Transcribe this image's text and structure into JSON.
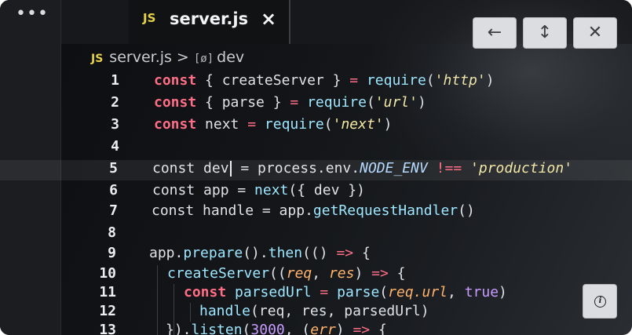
{
  "activity_bar": {
    "menu_icon": "more-horizontal-icon",
    "menu_glyph": "•••"
  },
  "tab": {
    "icon_label": "JS",
    "file_name": "server.js",
    "close_glyph": "×"
  },
  "breadcrumb": {
    "file_icon_label": "JS",
    "file": "server.js",
    "separator": ">",
    "symbol_icon": "[ø]",
    "symbol": "dev"
  },
  "code_lines": [
    {
      "n": "1",
      "tokens": [
        [
          "kw",
          "const "
        ],
        [
          "t",
          "{ createServer } "
        ],
        [
          "op",
          "= "
        ],
        [
          "fn",
          "require"
        ],
        [
          "t",
          "("
        ],
        [
          "str",
          "'http'"
        ],
        [
          "t",
          ")"
        ]
      ]
    },
    {
      "n": "2",
      "tokens": [
        [
          "kw",
          "const "
        ],
        [
          "t",
          "{ parse } "
        ],
        [
          "op",
          "= "
        ],
        [
          "fn",
          "require"
        ],
        [
          "t",
          "("
        ],
        [
          "str",
          "'url'"
        ],
        [
          "t",
          ")"
        ]
      ]
    },
    {
      "n": "3",
      "tokens": [
        [
          "kw",
          "const "
        ],
        [
          "t",
          "next "
        ],
        [
          "op",
          "= "
        ],
        [
          "fn",
          "require"
        ],
        [
          "t",
          "("
        ],
        [
          "str",
          "'next'"
        ],
        [
          "t",
          ")"
        ]
      ]
    },
    {
      "n": "4",
      "tokens": []
    },
    {
      "n": "5",
      "tokens": [
        [
          "t",
          "const dev"
        ],
        [
          "cursor",
          ""
        ],
        [
          "t",
          " = process.env."
        ],
        [
          "const",
          "NODE_ENV"
        ],
        [
          "t",
          " "
        ],
        [
          "op",
          "!=="
        ],
        [
          "t",
          " "
        ],
        [
          "str",
          "'production'"
        ]
      ]
    },
    {
      "n": "6",
      "tokens": [
        [
          "t",
          "const app = "
        ],
        [
          "fn",
          "next"
        ],
        [
          "t",
          "({ dev })"
        ]
      ]
    },
    {
      "n": "7",
      "tokens": [
        [
          "t",
          "const handle = app."
        ],
        [
          "fn",
          "getRequestHandler"
        ],
        [
          "t",
          "()"
        ]
      ]
    },
    {
      "n": "8",
      "tokens": []
    },
    {
      "n": "9",
      "tokens": [
        [
          "t",
          "app."
        ],
        [
          "fn",
          "prepare"
        ],
        [
          "t",
          "()."
        ],
        [
          "fn",
          "then"
        ],
        [
          "t",
          "(() "
        ],
        [
          "op",
          "=>"
        ],
        [
          "t",
          " {"
        ]
      ]
    },
    {
      "n": "10",
      "tokens": [
        [
          "fn",
          "createServer"
        ],
        [
          "t",
          "(("
        ],
        [
          "param",
          "req"
        ],
        [
          "t",
          ", "
        ],
        [
          "param",
          "res"
        ],
        [
          "t",
          ") "
        ],
        [
          "op",
          "=>"
        ],
        [
          "t",
          " {"
        ]
      ]
    },
    {
      "n": "11",
      "tokens": [
        [
          "kw",
          "const "
        ],
        [
          "fn",
          "parsedUrl"
        ],
        [
          "t",
          " "
        ],
        [
          "op",
          "="
        ],
        [
          "t",
          " "
        ],
        [
          "fn",
          "parse"
        ],
        [
          "t",
          "("
        ],
        [
          "param",
          "req.url"
        ],
        [
          "t",
          ", "
        ],
        [
          "num",
          "true"
        ],
        [
          "t",
          ")"
        ]
      ]
    },
    {
      "n": "12",
      "tokens": [
        [
          "fn",
          "handle"
        ],
        [
          "t",
          "(req, res, parsedUrl)"
        ]
      ]
    },
    {
      "n": "13",
      "tokens": [
        [
          "t",
          "})."
        ],
        [
          "fn",
          "listen"
        ],
        [
          "t",
          "("
        ],
        [
          "num",
          "3000"
        ],
        [
          "t",
          ", ("
        ],
        [
          "param",
          "err"
        ],
        [
          "t",
          ") "
        ],
        [
          "op",
          "=>"
        ],
        [
          "t",
          " {"
        ]
      ]
    }
  ],
  "controls": {
    "back_icon": "arrow-left-icon",
    "back_glyph": "←",
    "expand_icon": "arrows-vertical-icon",
    "expand_glyph": "↕",
    "close_icon": "close-icon",
    "close_glyph": "✕",
    "info_icon": "info-icon",
    "info_glyph": "i"
  }
}
